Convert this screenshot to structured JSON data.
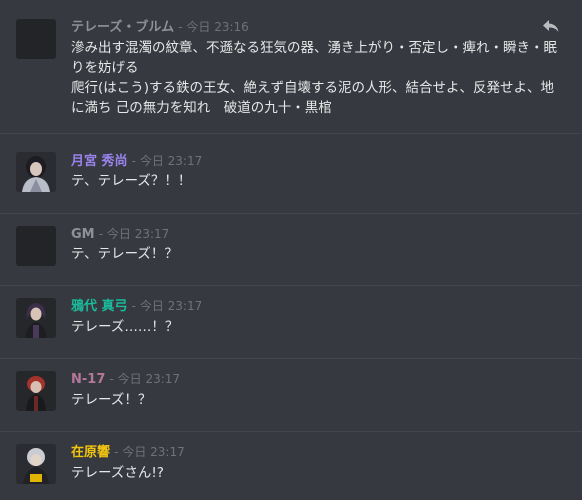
{
  "messages": [
    {
      "author": "テレーズ・ブルム",
      "author_color": "#8e9297",
      "timestamp": "今日 23:16",
      "text": "滲み出す混濁の紋章、不遜なる狂気の器、湧き上がり・否定し・痺れ・瞬き・眠りを妨げる\n爬行(はこう)する鉄の王女、絶えず自壊する泥の人形、結合せよ、反発せよ、地に満ち 己の無力を知れ　破道の九十・黒棺",
      "avatar": "blank-avatar",
      "reply_icon": "reply-icon"
    },
    {
      "author": "月宮 秀尚",
      "author_color": "#9b84ee",
      "timestamp": "今日 23:17",
      "text": "テ、テレーズ？！！",
      "avatar": "character-avatar-dark-hair"
    },
    {
      "author": "GM",
      "author_color": "#8e9297",
      "timestamp": "今日 23:17",
      "text": "テ、テレーズ！？",
      "avatar": "blank-avatar"
    },
    {
      "author": "鴉代 真弓",
      "author_color": "#1abc9c",
      "timestamp": "今日 23:17",
      "text": "テレーズ……！？",
      "avatar": "character-avatar-purple-hair"
    },
    {
      "author": "N-17",
      "author_color": "#b5779b",
      "timestamp": "今日 23:17",
      "text": "テレーズ！？",
      "avatar": "character-avatar-red-hair"
    },
    {
      "author": "在原響",
      "author_color": "#f1c40f",
      "timestamp": "今日 23:17",
      "text": "テレーズさん!?",
      "avatar": "character-avatar-silver-hair"
    }
  ]
}
